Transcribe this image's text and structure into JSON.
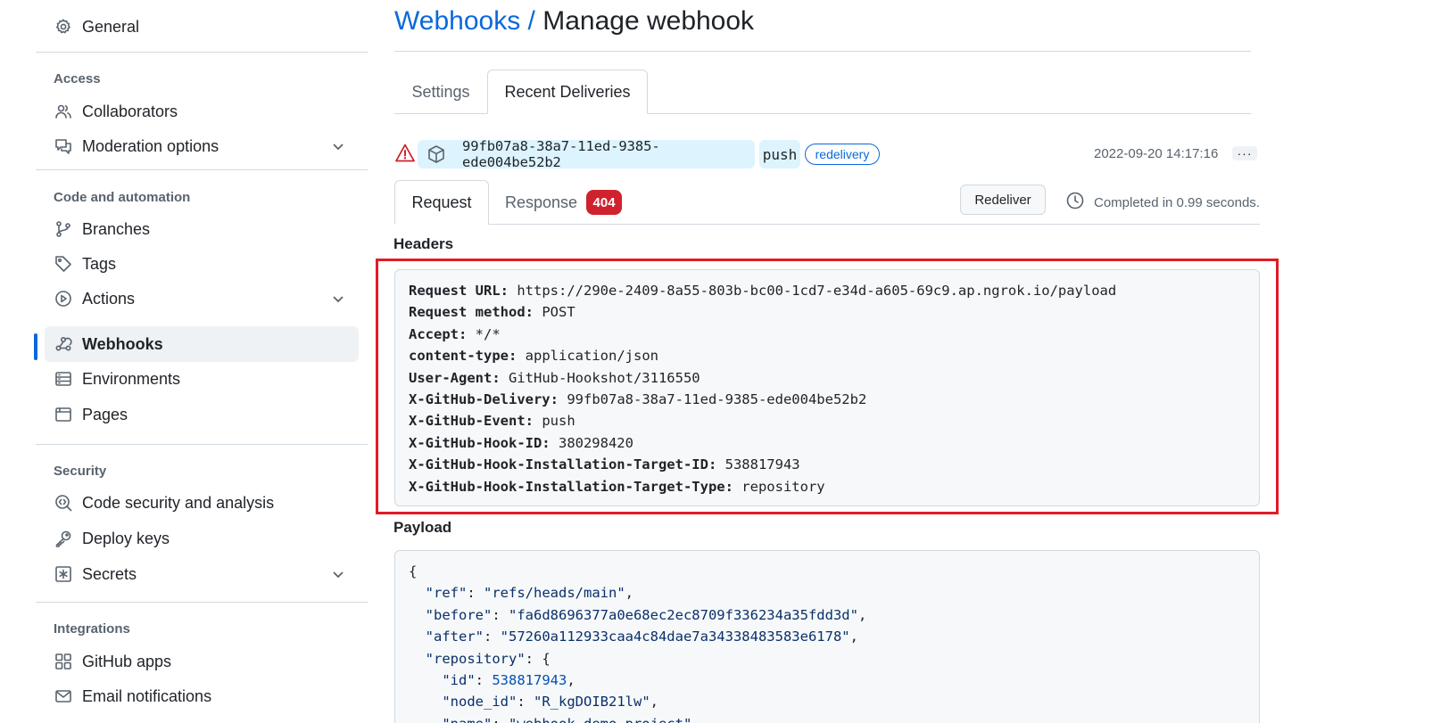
{
  "sidebar": {
    "items": [
      {
        "label": "General",
        "icon": "gear-icon"
      },
      {
        "label": "Collaborators",
        "icon": "people-icon"
      },
      {
        "label": "Moderation options",
        "icon": "comment-discussion-icon"
      },
      {
        "label": "Branches",
        "icon": "git-branch-icon"
      },
      {
        "label": "Tags",
        "icon": "tag-icon"
      },
      {
        "label": "Actions",
        "icon": "play-icon"
      },
      {
        "label": "Webhooks",
        "icon": "webhook-icon"
      },
      {
        "label": "Environments",
        "icon": "server-icon"
      },
      {
        "label": "Pages",
        "icon": "browser-icon"
      },
      {
        "label": "Code security and analysis",
        "icon": "codescan-icon"
      },
      {
        "label": "Deploy keys",
        "icon": "key-icon"
      },
      {
        "label": "Secrets",
        "icon": "key-asterisk-icon"
      },
      {
        "label": "GitHub apps",
        "icon": "apps-icon"
      },
      {
        "label": "Email notifications",
        "icon": "mail-icon"
      }
    ],
    "sections": {
      "access": "Access",
      "code_automation": "Code and automation",
      "security": "Security",
      "integrations": "Integrations"
    }
  },
  "page": {
    "breadcrumb": "Webhooks",
    "separator": " / ",
    "title": "Manage webhook"
  },
  "tabs": {
    "settings": "Settings",
    "recent": "Recent Deliveries"
  },
  "delivery": {
    "guid": "99fb07a8-38a7-11ed-9385-ede004be52b2",
    "event": "push",
    "badge": "redelivery",
    "timestamp": "2022-09-20 14:17:16",
    "more": "···",
    "status_color": "#cf222e"
  },
  "detail_tabs": {
    "request": "Request",
    "response": "Response",
    "response_code": "404"
  },
  "redeliver_label": "Redeliver",
  "completed_text": "Completed in 0.99 seconds.",
  "headers_label": "Headers",
  "headers": [
    {
      "key": "Request URL:",
      "value": "https://290e-2409-8a55-803b-bc00-1cd7-e34d-a605-69c9.ap.ngrok.io/payload"
    },
    {
      "key": "Request method:",
      "value": "POST"
    },
    {
      "key": "Accept:",
      "value": "*/*"
    },
    {
      "key": "content-type:",
      "value": "application/json"
    },
    {
      "key": "User-Agent:",
      "value": "GitHub-Hookshot/3116550"
    },
    {
      "key": "X-GitHub-Delivery:",
      "value": "99fb07a8-38a7-11ed-9385-ede004be52b2"
    },
    {
      "key": "X-GitHub-Event:",
      "value": "push"
    },
    {
      "key": "X-GitHub-Hook-ID:",
      "value": "380298420"
    },
    {
      "key": "X-GitHub-Hook-Installation-Target-ID:",
      "value": "538817943"
    },
    {
      "key": "X-GitHub-Hook-Installation-Target-Type:",
      "value": "repository"
    }
  ],
  "payload_label": "Payload",
  "payload_lines": [
    {
      "text": "{"
    },
    {
      "indent": "  ",
      "key": "\"ref\"",
      "sep": ": ",
      "value": "\"refs/heads/main\"",
      "tail": ","
    },
    {
      "indent": "  ",
      "key": "\"before\"",
      "sep": ": ",
      "value": "\"fa6d8696377a0e68ec2ec8709f336234a35fdd3d\"",
      "tail": ","
    },
    {
      "indent": "  ",
      "key": "\"after\"",
      "sep": ": ",
      "value": "\"57260a112933caa4c84dae7a34338483583e6178\"",
      "tail": ","
    },
    {
      "indent": "  ",
      "key": "\"repository\"",
      "sep": ": ",
      "value": "",
      "tail": "{"
    },
    {
      "indent": "    ",
      "key": "\"id\"",
      "sep": ": ",
      "num": "538817943",
      "tail": ","
    },
    {
      "indent": "    ",
      "key": "\"node_id\"",
      "sep": ": ",
      "value": "\"R_kgDOIB21lw\"",
      "tail": ","
    },
    {
      "indent": "    ",
      "key": "\"name\"",
      "sep": ": ",
      "value": "\"webhook-demo-project\"",
      "tail": ","
    }
  ]
}
